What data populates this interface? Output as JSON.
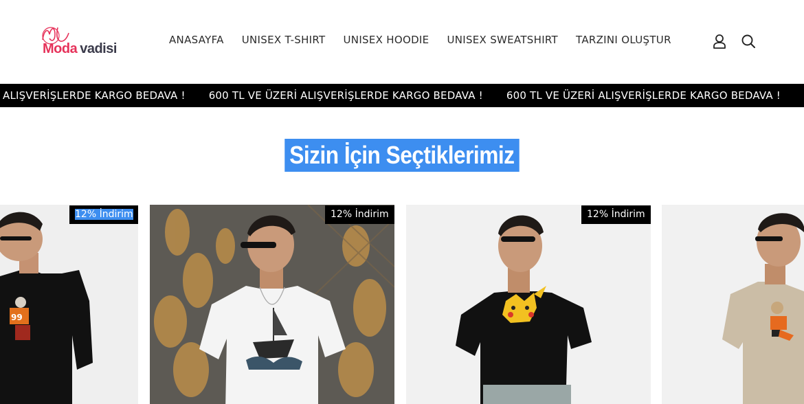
{
  "logo": {
    "script": "ML",
    "brand_part1": "Moda",
    "brand_part2": "vadisi"
  },
  "nav": [
    {
      "label": "ANASAYFA"
    },
    {
      "label": "UNISEX T-SHIRT"
    },
    {
      "label": "UNISEX HOODIE"
    },
    {
      "label": "UNISEX SWEATSHIRT"
    },
    {
      "label": "TARZINI OLUŞTUR"
    }
  ],
  "header_icons": [
    "user-icon",
    "search-icon"
  ],
  "announcement": {
    "items": [
      "ALIŞVERİŞLERDE KARGO BEDAVA !",
      "600 TL VE ÜZERİ ALIŞVERİŞLERDE KARGO BEDAVA !",
      "600 TL VE ÜZERİ ALIŞVERİŞLERDE KARGO BEDAVA !",
      "600"
    ]
  },
  "section": {
    "title": "Sizin İçin Seçtiklerimiz"
  },
  "products": [
    {
      "discount_badge": "12% İndirim",
      "shirt_color": "#111111",
      "print": "football-player-99"
    },
    {
      "discount_badge": "12% İndirim",
      "shirt_color": "#f4f4f4",
      "print": "ship-wave"
    },
    {
      "discount_badge": "12% İndirim",
      "shirt_color": "#111111",
      "print": "pikachu"
    },
    {
      "discount_badge": "",
      "shirt_color": "#cbbda6",
      "print": "goalkeeper"
    }
  ],
  "colors": {
    "accent_highlight": "#3d8ef0",
    "brand_pink": "#e6325a",
    "bar_background": "#000000"
  }
}
